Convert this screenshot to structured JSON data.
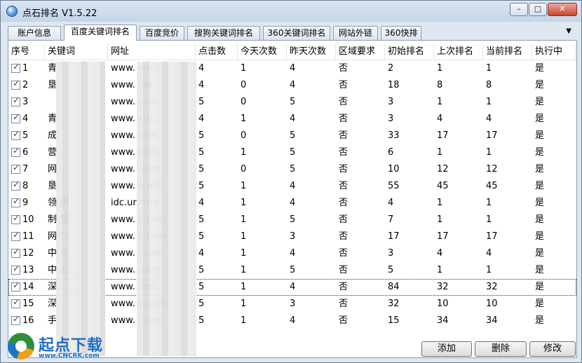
{
  "window": {
    "title": "点石排名 V1.5.22",
    "minimize": "–",
    "maximize": "□",
    "close": "✕"
  },
  "tabs": [
    {
      "label": "账户信息"
    },
    {
      "label": "百度关键词排名",
      "active": true
    },
    {
      "label": "百度竞价"
    },
    {
      "label": "搜狗关键词排名"
    },
    {
      "label": "360关键词排名"
    },
    {
      "label": "网站外链"
    },
    {
      "label": "360快排"
    }
  ],
  "tab_menu_arrow": "▼",
  "columns": [
    "序号",
    "关键词",
    "网址",
    "点击数",
    "今天次数",
    "昨天次数",
    "区域要求",
    "初始排名",
    "上次排名",
    "当前排名",
    "执行中"
  ],
  "rows": [
    {
      "no": "1",
      "kw": "青",
      "url": "www.       xin...",
      "clicks": "4",
      "today": "1",
      "yesterday": "4",
      "region": "否",
      "init": "2",
      "last": "1",
      "current": "1",
      "running": "是"
    },
    {
      "no": "2",
      "kw": "   垦",
      "url": "www.       net",
      "clicks": "4",
      "today": "0",
      "yesterday": "4",
      "region": "否",
      "init": "18",
      "last": "8",
      "current": "8",
      "running": "是"
    },
    {
      "no": "3",
      "kw": "   ",
      "url": "www.       com",
      "clicks": "5",
      "today": "0",
      "yesterday": "5",
      "region": "否",
      "init": "3",
      "last": "1",
      "current": "1",
      "running": "是"
    },
    {
      "no": "4",
      "kw": "   青",
      "url": "www.       xin...",
      "clicks": "4",
      "today": "1",
      "yesterday": "4",
      "region": "否",
      "init": "3",
      "last": "4",
      "current": "4",
      "running": "是"
    },
    {
      "no": "5",
      "kw": "   成",
      "url": "www.       com",
      "clicks": "5",
      "today": "0",
      "yesterday": "5",
      "region": "否",
      "init": "33",
      "last": "17",
      "current": "17",
      "running": "是"
    },
    {
      "no": "6",
      "kw": "   营",
      "url": "www.       com",
      "clicks": "5",
      "today": "1",
      "yesterday": "5",
      "region": "否",
      "init": "6",
      "last": "1",
      "current": "1",
      "running": "是"
    },
    {
      "no": "7",
      "kw": "   网",
      "url": "www.       .com",
      "clicks": "5",
      "today": "0",
      "yesterday": "5",
      "region": "否",
      "init": "10",
      "last": "12",
      "current": "12",
      "running": "是"
    },
    {
      "no": "8",
      "kw": "   垦",
      "url": "www.       g.net",
      "clicks": "5",
      "today": "1",
      "yesterday": "4",
      "region": "否",
      "init": "55",
      "last": "45",
      "current": "45",
      "running": "是"
    },
    {
      "no": "9",
      "kw": "领  案",
      "url": "idc.ur      com",
      "clicks": "4",
      "today": "1",
      "yesterday": "4",
      "region": "否",
      "init": "4",
      "last": "1",
      "current": "1",
      "running": "是"
    },
    {
      "no": "10",
      "kw": "制  营",
      "url": "www.       ji.com",
      "clicks": "5",
      "today": "1",
      "yesterday": "5",
      "region": "否",
      "init": "7",
      "last": "1",
      "current": "1",
      "running": "是"
    },
    {
      "no": "11",
      "kw": "网  SI",
      "url": "www.       ji.com",
      "clicks": "5",
      "today": "1",
      "yesterday": "3",
      "region": "否",
      "init": "17",
      "last": "17",
      "current": "17",
      "running": "是"
    },
    {
      "no": "12",
      "kw": "中  台",
      "url": "www.       r.com",
      "clicks": "4",
      "today": "1",
      "yesterday": "4",
      "region": "否",
      "init": "3",
      "last": "4",
      "current": "4",
      "running": "是"
    },
    {
      "no": "13",
      "kw": "中  名",
      "url": "www.       .com",
      "clicks": "5",
      "today": "1",
      "yesterday": "5",
      "region": "否",
      "init": "5",
      "last": "1",
      "current": "1",
      "running": "是"
    },
    {
      "no": "14",
      "kw": "深",
      "url": "www.       .net",
      "clicks": "5",
      "today": "1",
      "yesterday": "4",
      "region": "否",
      "init": "84",
      "last": "32",
      "current": "32",
      "running": "是",
      "selected": true
    },
    {
      "no": "15",
      "kw": "深",
      "url": "www.       ty.com",
      "clicks": "5",
      "today": "1",
      "yesterday": "3",
      "region": "否",
      "init": "32",
      "last": "10",
      "current": "10",
      "running": "是"
    },
    {
      "no": "16",
      "kw": "手",
      "url": "www.       i.com",
      "clicks": "5",
      "today": "1",
      "yesterday": "4",
      "region": "否",
      "init": "15",
      "last": "34",
      "current": "34",
      "running": "是"
    }
  ],
  "buttons": {
    "add": "添加",
    "delete": "删除",
    "edit": "修改"
  },
  "watermark": {
    "name": "起点下载",
    "url": "www.CNCRK.com"
  }
}
